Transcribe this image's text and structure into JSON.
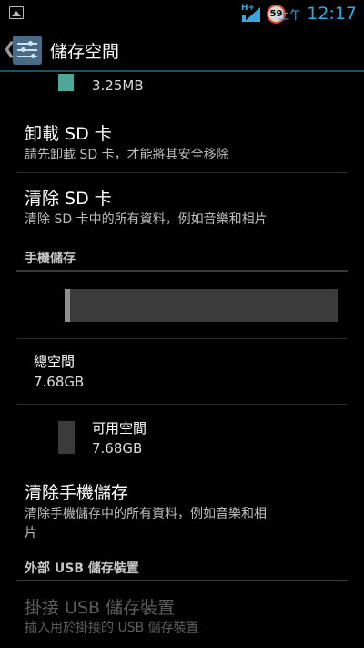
{
  "status_bar": {
    "network_type": "H+",
    "badge_count": "59",
    "ampm": "上午",
    "time": "12:17",
    "accent_color": "#36a8e0"
  },
  "action_bar": {
    "title": "儲存空間",
    "icon": "storage-settings-icon"
  },
  "sd_card": {
    "top_item_value": "3.25MB",
    "top_item_color": "#4fa79a",
    "unmount": {
      "title": "卸載 SD 卡",
      "summary": "請先卸載 SD 卡，才能將其安全移除"
    },
    "erase": {
      "title": "清除 SD 卡",
      "summary": "清除 SD 卡中的所有資料，例如音樂和相片"
    }
  },
  "phone_storage": {
    "header": "手機儲存",
    "used_fraction": 0.02,
    "total": {
      "label": "總空間",
      "value": "7.68GB"
    },
    "available": {
      "label": "可用空間",
      "value": "7.68GB"
    },
    "erase": {
      "title": "清除手機儲存",
      "summary_line1": "清除手機儲存中的所有資料，例如音樂和相",
      "summary_line2": "片"
    }
  },
  "usb_storage": {
    "header": "外部 USB 儲存裝置",
    "mount": {
      "title": "掛接 USB 儲存裝置",
      "summary": "插入用於掛接的 USB 儲存裝置",
      "enabled": false
    }
  }
}
